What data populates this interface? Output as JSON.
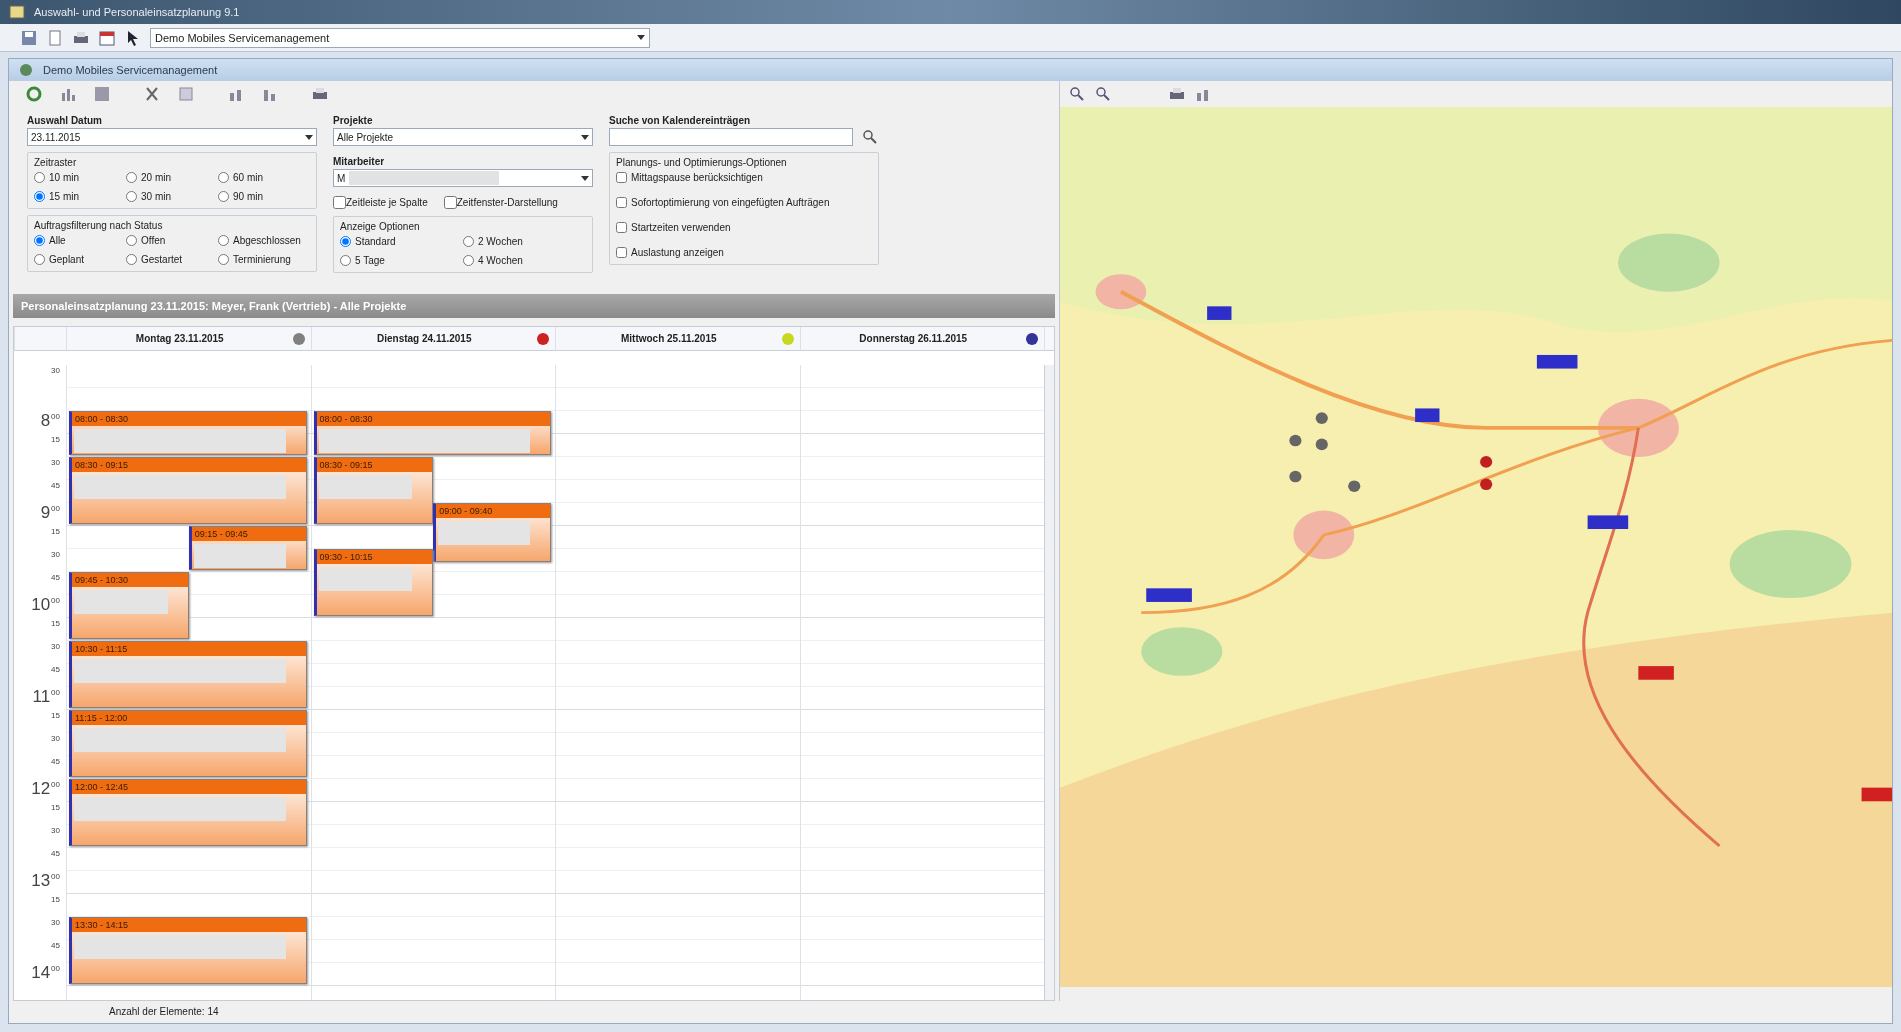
{
  "window": {
    "title": "Auswahl- und Personaleinsatzplanung 9.1"
  },
  "toolbar": {
    "project_select": "Demo Mobiles Servicemanagement"
  },
  "inner_window": {
    "title": "Demo Mobiles Servicemanagement"
  },
  "filters": {
    "date": {
      "label": "Auswahl Datum",
      "value": "23.11.2015"
    },
    "time_grid": {
      "label": "Zeitraster",
      "options": [
        {
          "label": "10 min",
          "selected": false
        },
        {
          "label": "20 min",
          "selected": false
        },
        {
          "label": "60 min",
          "selected": false
        },
        {
          "label": "15 min",
          "selected": true
        },
        {
          "label": "30 min",
          "selected": false
        },
        {
          "label": "90 min",
          "selected": false
        }
      ]
    },
    "status_filter": {
      "label": "Auftragsfilterung nach Status",
      "options": [
        {
          "label": "Alle",
          "selected": true
        },
        {
          "label": "Offen",
          "selected": false
        },
        {
          "label": "Abgeschlossen",
          "selected": false
        },
        {
          "label": "Geplant",
          "selected": false
        },
        {
          "label": "Gestartet",
          "selected": false
        },
        {
          "label": "Terminierung",
          "selected": false
        }
      ]
    },
    "projects": {
      "label": "Projekte",
      "value": "Alle Projekte"
    },
    "staff": {
      "label": "Mitarbeiter",
      "value": "M"
    },
    "staff_options": [
      {
        "label": "Zeitleiste je Spalte",
        "checked": false
      },
      {
        "label": "Zeitfenster-Darstellung",
        "checked": false
      }
    ],
    "view_options": {
      "label": "Anzeige Optionen",
      "options": [
        {
          "label": "Standard",
          "selected": true
        },
        {
          "label": "2 Wochen",
          "selected": false
        },
        {
          "label": "5 Tage",
          "selected": false
        },
        {
          "label": "4 Wochen",
          "selected": false
        }
      ]
    },
    "search": {
      "label": "Suche von Kalendereinträgen"
    },
    "planning": {
      "label": "Planungs- und Optimierungs-Optionen",
      "options": [
        {
          "label": "Mittagspause berücksichtigen",
          "checked": false
        },
        {
          "label": "Sofortoptimierung von eingefügten Aufträgen",
          "checked": false
        },
        {
          "label": "Startzeiten verwenden",
          "checked": false
        },
        {
          "label": "Auslastung anzeigen",
          "checked": false
        }
      ]
    }
  },
  "plan_header": "Personaleinsatzplanung 23.11.2015: Meyer, Frank (Vertrieb) - Alle Projekte",
  "calendar": {
    "time_rows": [
      {
        "minute": "30"
      },
      {},
      {
        "hour": "8",
        "minute": "00"
      },
      {
        "minute": "15"
      },
      {
        "minute": "30"
      },
      {
        "minute": "45"
      },
      {
        "hour": "9",
        "minute": "00"
      },
      {
        "minute": "15"
      },
      {
        "minute": "30"
      },
      {
        "minute": "45"
      },
      {
        "hour": "10",
        "minute": "00"
      },
      {
        "minute": "15"
      },
      {
        "minute": "30"
      },
      {
        "minute": "45"
      },
      {
        "hour": "11",
        "minute": "00"
      },
      {
        "minute": "15"
      },
      {
        "minute": "30"
      },
      {
        "minute": "45"
      },
      {
        "hour": "12",
        "minute": "00"
      },
      {
        "minute": "15"
      },
      {
        "minute": "30"
      },
      {
        "minute": "45"
      },
      {
        "hour": "13",
        "minute": "00"
      },
      {
        "minute": "15"
      },
      {
        "minute": "30"
      },
      {
        "minute": "45"
      },
      {
        "hour": "14",
        "minute": "00"
      }
    ],
    "days": [
      {
        "label": "Montag 23.11.2015",
        "color": "#808080",
        "events": [
          {
            "header": "08:00 - 08:30",
            "kind": "full"
          },
          {
            "header": "08:30 - 09:15",
            "kind": "full"
          },
          {
            "header": "09:15 - 09:45",
            "kind": "right"
          },
          {
            "header": "09:45 - 10:30",
            "kind": "left"
          },
          {
            "header": "10:30 - 11:15",
            "kind": "full"
          },
          {
            "header": "11:15 - 12:00",
            "kind": "full"
          },
          {
            "header": "12:00 - 12:45",
            "kind": "full"
          },
          {
            "header": "13:30 - 14:15",
            "kind": "full"
          }
        ]
      },
      {
        "label": "Dienstag 24.11.2015",
        "color": "#cc2222",
        "events": [
          {
            "header": "08:00 - 08:30",
            "kind": "full"
          },
          {
            "header": "08:30 - 09:15",
            "kind": "left"
          },
          {
            "header": "09:00 - 09:40",
            "kind": "right"
          },
          {
            "header": "09:30 - 10:15",
            "kind": "left"
          }
        ]
      },
      {
        "label": "Mittwoch 25.11.2015",
        "color": "#c8d820"
      },
      {
        "label": "Donnerstag 26.11.2015",
        "color": "#333399"
      }
    ]
  },
  "status_bar": "Anzahl der Elemente: 14"
}
